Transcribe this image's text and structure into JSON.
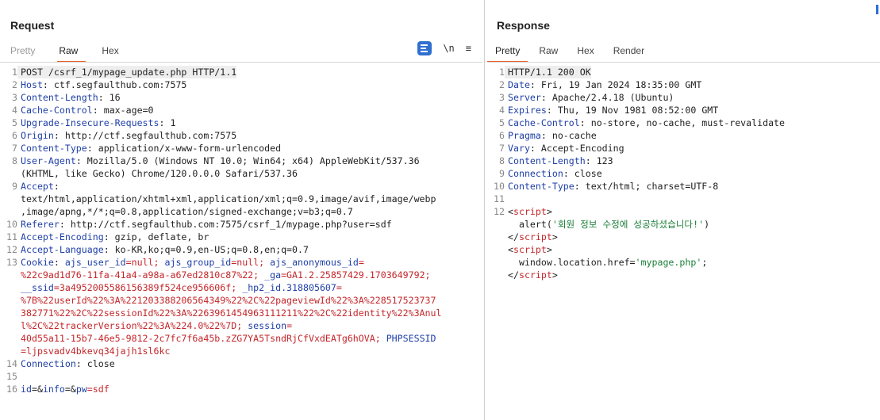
{
  "request": {
    "title": "Request",
    "tabs": [
      {
        "label": "Pretty",
        "state": "muted"
      },
      {
        "label": "Raw",
        "state": "active"
      },
      {
        "label": "Hex",
        "state": "normal"
      }
    ],
    "tools": {
      "wrap_icon": "wrap-lines-icon",
      "newline_label": "\\n",
      "menu_label": "≡"
    },
    "lines": [
      {
        "n": "1",
        "segs": [
          [
            "POST /csrf_1/mypage_update.php HTTP/1.1",
            ""
          ]
        ],
        "hl": true
      },
      {
        "n": "2",
        "segs": [
          [
            "Host",
            "k"
          ],
          [
            ": ctf.segfaulthub.com:7575",
            ""
          ]
        ]
      },
      {
        "n": "3",
        "segs": [
          [
            "Content-Length",
            "k"
          ],
          [
            ": 16",
            ""
          ]
        ]
      },
      {
        "n": "4",
        "segs": [
          [
            "Cache-Control",
            "k"
          ],
          [
            ": max-age=0",
            ""
          ]
        ]
      },
      {
        "n": "5",
        "segs": [
          [
            "Upgrade-Insecure-Requests",
            "k"
          ],
          [
            ": 1",
            ""
          ]
        ]
      },
      {
        "n": "6",
        "segs": [
          [
            "Origin",
            "k"
          ],
          [
            ": http://ctf.segfaulthub.com:7575",
            ""
          ]
        ]
      },
      {
        "n": "7",
        "segs": [
          [
            "Content-Type",
            "k"
          ],
          [
            ": application/x-www-form-urlencoded",
            ""
          ]
        ]
      },
      {
        "n": "8",
        "segs": [
          [
            "User-Agent",
            "k"
          ],
          [
            ": Mozilla/5.0 (Windows NT 10.0; Win64; x64) AppleWebKit/537.36",
            ""
          ]
        ]
      },
      {
        "n": "",
        "segs": [
          [
            "(KHTML, like Gecko) Chrome/120.0.0.0 Safari/537.36",
            ""
          ]
        ]
      },
      {
        "n": "9",
        "segs": [
          [
            "Accept",
            "k"
          ],
          [
            ":",
            ""
          ]
        ]
      },
      {
        "n": "",
        "segs": [
          [
            "text/html,application/xhtml+xml,application/xml;q=0.9,image/avif,image/webp",
            ""
          ]
        ]
      },
      {
        "n": "",
        "segs": [
          [
            ",image/apng,*/*;q=0.8,application/signed-exchange;v=b3;q=0.7",
            ""
          ]
        ]
      },
      {
        "n": "10",
        "segs": [
          [
            "Referer",
            "k"
          ],
          [
            ": http://ctf.segfaulthub.com:7575/csrf_1/mypage.php?user=sdf",
            ""
          ]
        ]
      },
      {
        "n": "11",
        "segs": [
          [
            "Accept-Encoding",
            "k"
          ],
          [
            ": gzip, deflate, br",
            ""
          ]
        ]
      },
      {
        "n": "12",
        "segs": [
          [
            "Accept-Language",
            "k"
          ],
          [
            ": ko-KR,ko;q=0.9,en-US;q=0.8,en;q=0.7",
            ""
          ]
        ]
      },
      {
        "n": "13",
        "segs": [
          [
            "Cookie",
            "k"
          ],
          [
            ": ",
            ""
          ],
          [
            "ajs_user_id",
            "k"
          ],
          [
            "=null; ",
            "red"
          ],
          [
            "ajs_group_id",
            "k"
          ],
          [
            "=null; ",
            "red"
          ],
          [
            "ajs_anonymous_id",
            "k"
          ],
          [
            "=",
            "red"
          ]
        ]
      },
      {
        "n": "",
        "segs": [
          [
            "%22c9ad1d76-11fa-41a4-a98a-a67ed2810c87%22; ",
            "red"
          ],
          [
            "_ga",
            "k"
          ],
          [
            "=GA1.2.25857429.1703649792;",
            "red"
          ]
        ]
      },
      {
        "n": "",
        "segs": [
          [
            "__ssid",
            "k"
          ],
          [
            "=3a4952005586156389f524ce956606f; ",
            "red"
          ],
          [
            "_hp2_id.318805607",
            "k"
          ],
          [
            "=",
            "red"
          ]
        ]
      },
      {
        "n": "",
        "segs": [
          [
            "%7B%22userId%22%3A%221203388206564349%22%2C%22pageviewId%22%3A%228517523737",
            "red"
          ]
        ]
      },
      {
        "n": "",
        "segs": [
          [
            "382771%22%2C%22sessionId%22%3A%2263961454963111211%22%2C%22identity%22%3Anul",
            "red"
          ]
        ]
      },
      {
        "n": "",
        "segs": [
          [
            "l%2C%22trackerVersion%22%3A%224.0%22%7D; ",
            "red"
          ],
          [
            "session",
            "k"
          ],
          [
            "=",
            "red"
          ]
        ]
      },
      {
        "n": "",
        "segs": [
          [
            "40d55a11-15b7-46e5-9812-2c7fc7f6a45b.zZG7YA5TsndRjCfVxdEATg6hOVA; ",
            "red"
          ],
          [
            "PHPSESSID",
            "k"
          ]
        ]
      },
      {
        "n": "",
        "segs": [
          [
            "=ljpsvadv4bkevq34jajh1sl6kc",
            "red"
          ]
        ]
      },
      {
        "n": "14",
        "segs": [
          [
            "Connection",
            "k"
          ],
          [
            ": close",
            ""
          ]
        ]
      },
      {
        "n": "15",
        "segs": [
          [
            "",
            ""
          ]
        ]
      },
      {
        "n": "16",
        "segs": [
          [
            "id",
            "k"
          ],
          [
            "=&",
            ""
          ],
          [
            "info",
            "k"
          ],
          [
            "=&",
            ""
          ],
          [
            "pw",
            "k"
          ],
          [
            "=sdf",
            "red"
          ]
        ]
      }
    ]
  },
  "response": {
    "title": "Response",
    "tabs": [
      {
        "label": "Pretty",
        "state": "active"
      },
      {
        "label": "Raw",
        "state": "normal"
      },
      {
        "label": "Hex",
        "state": "normal"
      },
      {
        "label": "Render",
        "state": "normal"
      }
    ],
    "lines": [
      {
        "n": "1",
        "segs": [
          [
            "HTTP/1.1 200 OK",
            ""
          ]
        ],
        "hl": true
      },
      {
        "n": "2",
        "segs": [
          [
            "Date",
            "k"
          ],
          [
            ": Fri, 19 Jan 2024 18:35:00 GMT",
            ""
          ]
        ]
      },
      {
        "n": "3",
        "segs": [
          [
            "Server",
            "k"
          ],
          [
            ": Apache/2.4.18 (Ubuntu)",
            ""
          ]
        ]
      },
      {
        "n": "4",
        "segs": [
          [
            "Expires",
            "k"
          ],
          [
            ": Thu, 19 Nov 1981 08:52:00 GMT",
            ""
          ]
        ]
      },
      {
        "n": "5",
        "segs": [
          [
            "Cache-Control",
            "k"
          ],
          [
            ": no-store, no-cache, must-revalidate",
            ""
          ]
        ]
      },
      {
        "n": "6",
        "segs": [
          [
            "Pragma",
            "k"
          ],
          [
            ": no-cache",
            ""
          ]
        ]
      },
      {
        "n": "7",
        "segs": [
          [
            "Vary",
            "k"
          ],
          [
            ": Accept-Encoding",
            ""
          ]
        ]
      },
      {
        "n": "8",
        "segs": [
          [
            "Content-Length",
            "k"
          ],
          [
            ": 123",
            ""
          ]
        ]
      },
      {
        "n": "9",
        "segs": [
          [
            "Connection",
            "k"
          ],
          [
            ": close",
            ""
          ]
        ]
      },
      {
        "n": "10",
        "segs": [
          [
            "Content-Type",
            "k"
          ],
          [
            ": text/html; charset=UTF-8",
            ""
          ]
        ]
      },
      {
        "n": "11",
        "segs": [
          [
            "",
            ""
          ]
        ]
      },
      {
        "n": "12",
        "segs": [
          [
            "<",
            ""
          ],
          [
            "script",
            "red"
          ],
          [
            ">",
            ""
          ]
        ]
      },
      {
        "n": "",
        "segs": [
          [
            "  alert(",
            ""
          ],
          [
            "'회원 정보 수정에 성공하셨습니다!'",
            "grn"
          ],
          [
            ")",
            ""
          ]
        ]
      },
      {
        "n": "",
        "segs": [
          [
            "</",
            ""
          ],
          [
            "script",
            "red"
          ],
          [
            ">",
            ""
          ]
        ]
      },
      {
        "n": "",
        "segs": [
          [
            "<",
            ""
          ],
          [
            "script",
            "red"
          ],
          [
            ">",
            ""
          ]
        ]
      },
      {
        "n": "",
        "segs": [
          [
            "  window.location.href=",
            ""
          ],
          [
            "'mypage.php'",
            "grn"
          ],
          [
            ";",
            ""
          ]
        ]
      },
      {
        "n": "",
        "segs": [
          [
            "</",
            ""
          ],
          [
            "script",
            "red"
          ],
          [
            ">",
            ""
          ]
        ]
      }
    ]
  }
}
